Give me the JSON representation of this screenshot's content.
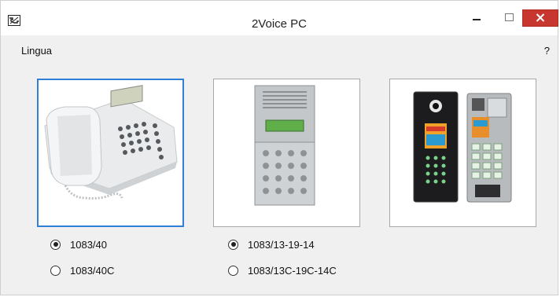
{
  "window": {
    "title": "2Voice PC",
    "app_icon": "phone-app-icon",
    "controls": {
      "minimize": "minimize-icon",
      "maximize": "maximize-icon",
      "close": "close-icon"
    }
  },
  "menu": {
    "lingua": "Lingua",
    "help": "?"
  },
  "colors": {
    "selection": "#2f7fd6",
    "close_button": "#c7372f"
  },
  "devices": [
    {
      "image": "desk-phone",
      "selected": true,
      "options": [
        {
          "label": "1083/40",
          "checked": true
        },
        {
          "label": "1083/40C",
          "checked": false
        }
      ]
    },
    {
      "image": "keypad-door-panel",
      "selected": false,
      "options": [
        {
          "label": "1083/13-19-14",
          "checked": true
        },
        {
          "label": "1083/13C-19C-14C",
          "checked": false
        }
      ]
    },
    {
      "image": "video-door-panels",
      "selected": false,
      "options": []
    }
  ]
}
